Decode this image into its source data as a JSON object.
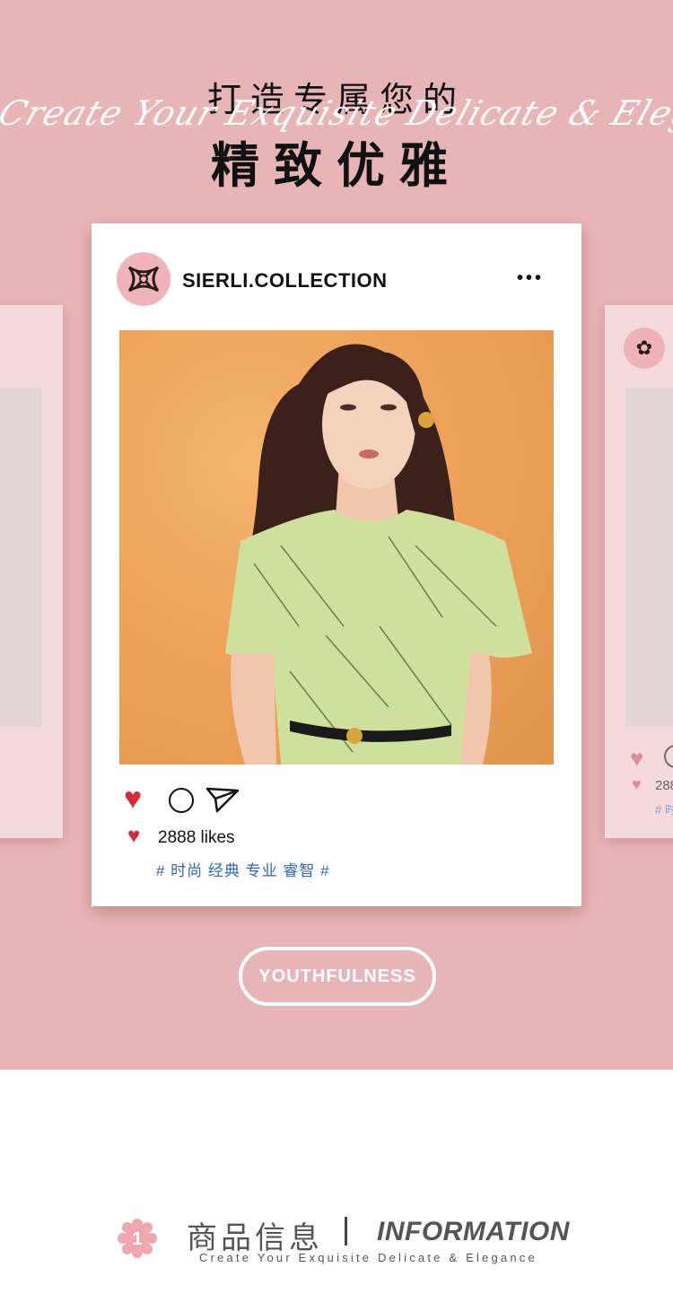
{
  "hero": {
    "title_line1": "打造专属您的",
    "script_text": "Create Your Exquisite Delicate & Elegance",
    "title_line2": "精致优雅"
  },
  "post": {
    "brand": "SIERLI.COLLECTION",
    "more": "•••",
    "likes": "2888 likes",
    "hashtags": "# 时尚 经典 专业 睿智 #"
  },
  "side_post": {
    "likes_partial": "288",
    "tag_partial": "# 时"
  },
  "badge": {
    "label": "YOUTHFULNESS"
  },
  "info": {
    "number": "1",
    "title_cn": "商品信息",
    "title_en": "INFORMATION",
    "subtitle": "Create Your Exquisite Delicate & Elegance"
  },
  "colors": {
    "background_pink": "#e8b5b7",
    "heart_red": "#d42a3c",
    "hashtag_blue": "#2f66b5",
    "logo_pink": "#f1b3bb"
  },
  "icons": [
    "heart-icon",
    "comment-icon",
    "send-icon",
    "more-icon",
    "brand-logo",
    "flower-number-icon"
  ]
}
